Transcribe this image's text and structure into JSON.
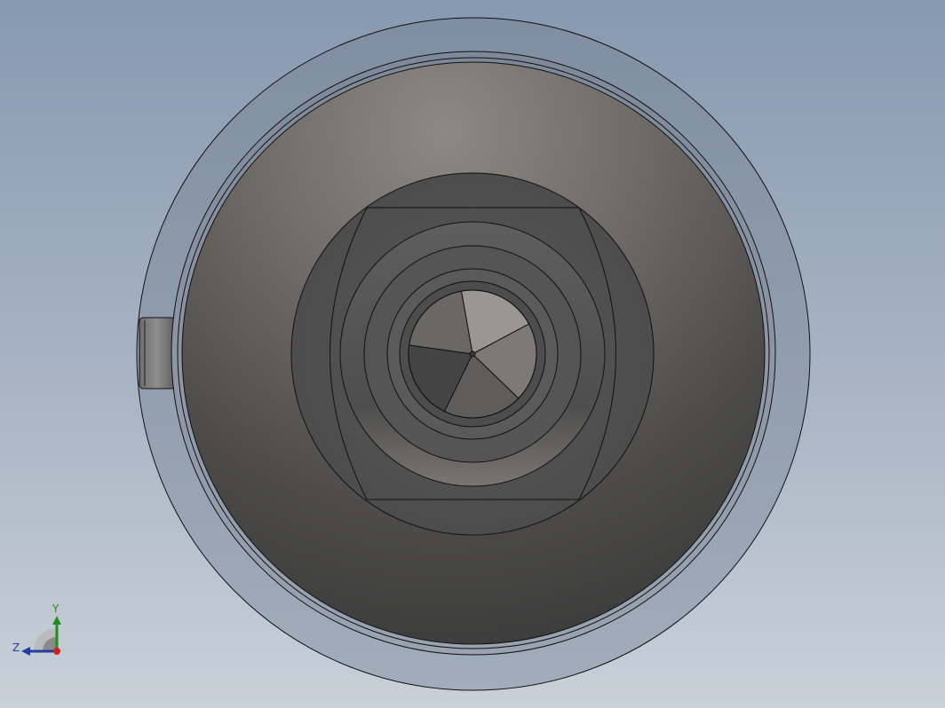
{
  "viewport": {
    "background_top": "#8799b0",
    "background_bottom": "#c9d0d8"
  },
  "model": {
    "view": "front",
    "part": "cylindrical-housing",
    "colors": {
      "outer_flange": "#8c9aab",
      "rim": "#8a96a4",
      "bore_light": "#8d8882",
      "bore_dark": "#3b3b3b",
      "inner_pocket": "#555555",
      "edge": "#111111"
    },
    "fan_blades": 5
  },
  "triad": {
    "x_axis_color": "#cc2222",
    "y_axis_color": "#228b22",
    "z_axis_color": "#1f3f9f",
    "y_label": "Y",
    "z_label": "Z"
  }
}
